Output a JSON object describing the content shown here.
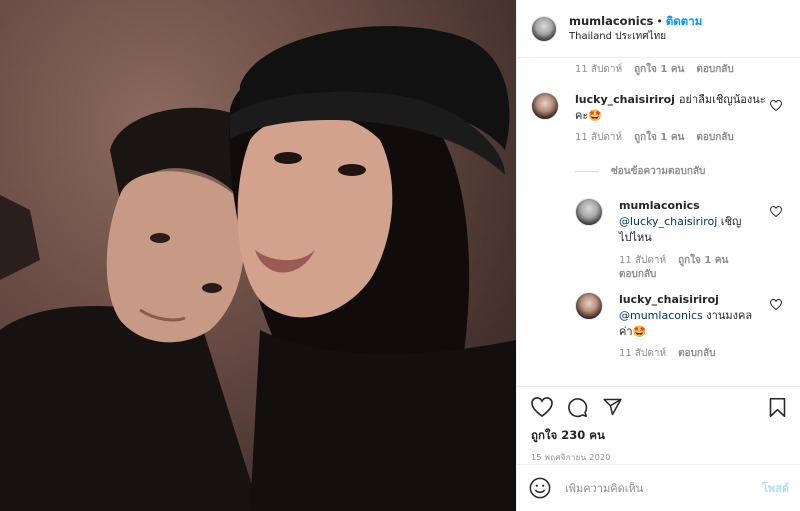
{
  "header": {
    "username": "mumlaconics",
    "separator": "•",
    "follow_label": "ติดตาม",
    "location": "Thailand ประเทศไทย"
  },
  "comments": {
    "top_partial_meta": {
      "time": "11 สัปดาห์",
      "likes": "ถูกใจ 1 คน",
      "reply": "ตอบกลับ"
    },
    "main_comment": {
      "username": "lucky_chaisiriroj",
      "text_line1": "อย่าลืมเชิญน้องนะ",
      "text_line2": "คะ🤩",
      "time": "11 สัปดาห์",
      "likes": "ถูกใจ 1 คน",
      "reply": "ตอบกลับ"
    },
    "hide_replies_label": "ซ่อนข้อความตอบกลับ",
    "replies": [
      {
        "username": "mumlaconics",
        "mention": "@lucky_chaisiriroj",
        "text_after_mention": " เชิญ",
        "text_line2": "ไปไหน",
        "time": "11 สัปดาห์",
        "likes": "ถูกใจ 1 คน",
        "reply": "ตอบกลับ"
      },
      {
        "username": "lucky_chaisiriroj",
        "mention": "@mumlaconics",
        "text_after_mention": " งานมงคล",
        "text_line2": "ค่า🤩",
        "time": "11 สัปดาห์",
        "reply": "ตอบกลับ"
      }
    ]
  },
  "actions": {
    "likes_text": "ถูกใจ 230 คน",
    "date": "15 พฤศจิกายน 2020"
  },
  "compose": {
    "placeholder": "เพิ่มความคิดเห็น",
    "post_label": "โพสต์"
  },
  "icons": {
    "like": "heart-icon",
    "comment": "comment-icon",
    "share": "share-icon",
    "save": "bookmark-icon",
    "emoji": "emoji-icon"
  },
  "colors": {
    "follow": "#0095f6",
    "post_disabled": "#b2dffc",
    "secondary_text": "#8e8e8e"
  }
}
